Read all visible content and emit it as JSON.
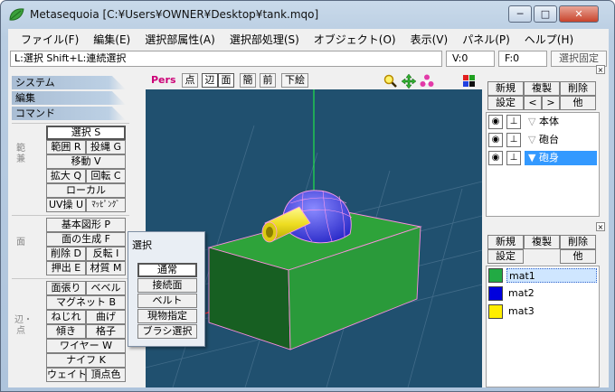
{
  "window": {
    "title": "Metasequoia [C:¥Users¥OWNER¥Desktop¥tank.mqo]",
    "minimize": "─",
    "maximize": "□",
    "close": "✕"
  },
  "menu": [
    "ファイル(F)",
    "編集(E)",
    "選択部属性(A)",
    "選択部処理(S)",
    "オブジェクト(O)",
    "表示(V)",
    "パネル(P)",
    "ヘルプ(H)"
  ],
  "status": {
    "hint": "L:選択  Shift+L:連続選択",
    "vertex": "V:0",
    "face": "F:0",
    "fix_selection": "選択固定"
  },
  "left_panel": {
    "sections": [
      "システム",
      "編集",
      "コマンド"
    ],
    "command_group_labels": {
      "edit": "範 兼",
      "face": "面",
      "edge": "辺・点"
    },
    "command_buttons": {
      "select": "選択 S",
      "range": "範囲 R",
      "lasso": "投縄 G",
      "move": "移動 V",
      "scale": "拡大 Q",
      "rotate": "回転 C",
      "local": "ローカル",
      "uv": "UV操 U",
      "mapping": "ﾏｯﾋﾟﾝｸﾞ",
      "primitive": "基本図形 P",
      "face_create": "面の生成 F",
      "delete": "削除 D",
      "flip": "反転 I",
      "extrude": "押出 E",
      "material": "材質 M",
      "face_stretch": "面張り",
      "bevel": "ベベル",
      "magnet": "マグネット B",
      "twist": "ねじれ",
      "bend": "曲げ",
      "tilt": "傾き",
      "lattice": "格子",
      "wire": "ワイヤー W",
      "knife": "ナイフ K",
      "weight": "ウェイト",
      "vertex_color": "頂点色"
    }
  },
  "popup": {
    "title": "選択",
    "options": [
      "通常",
      "接続面",
      "ベルト",
      "現物指定",
      "ブラシ選択"
    ],
    "active_index": 0
  },
  "viewport": {
    "projection": "Pers",
    "modes": [
      "点",
      "辺",
      "面",
      "簡",
      "前",
      "下絵"
    ],
    "active_modes": [
      "辺",
      "面"
    ],
    "icons": [
      "zoom-icon",
      "pan-icon",
      "rotate-icon",
      "color-icon"
    ],
    "background_color": "#20506f"
  },
  "object_panel": {
    "buttons": [
      "新規",
      "複製",
      "削除",
      "設定",
      "<",
      ">",
      "他"
    ],
    "objects": [
      {
        "name": "本体",
        "expanded": false,
        "selected": false
      },
      {
        "name": "砲台",
        "expanded": false,
        "selected": false
      },
      {
        "name": "砲身",
        "expanded": true,
        "selected": true
      }
    ],
    "eye_glyph": "◉",
    "lock_glyph": "⊥"
  },
  "material_panel": {
    "buttons": [
      "新規",
      "複製",
      "削除",
      "設定",
      "他"
    ],
    "materials": [
      {
        "name": "mat1",
        "color": "#22aa44",
        "selected": true
      },
      {
        "name": "mat2",
        "color": "#0000dd",
        "selected": false
      },
      {
        "name": "mat3",
        "color": "#ffee00",
        "selected": false
      }
    ]
  },
  "model_colors": {
    "body": "#2a9a3a",
    "turret": "#3a3ad8",
    "barrel": "#f0e020"
  }
}
